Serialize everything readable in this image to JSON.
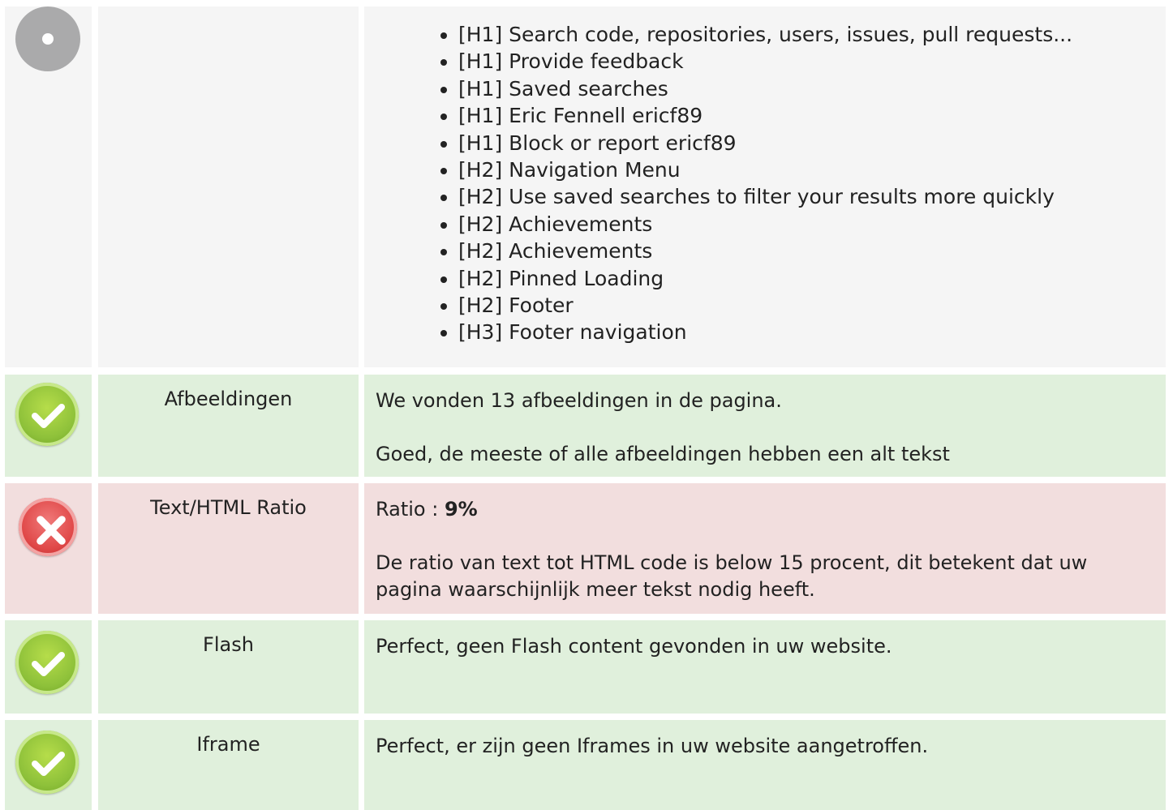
{
  "headings": {
    "status_icon": "info-circle-icon",
    "items": [
      "[H1] Search code, repositories, users, issues, pull requests...",
      "[H1] Provide feedback",
      "[H1] Saved searches",
      "[H1] Eric Fennell ericf89",
      "[H1] Block or report ericf89",
      "[H2] Navigation Menu",
      "[H2] Use saved searches to filter your results more quickly",
      "[H2] Achievements",
      "[H2] Achievements",
      "[H2] Pinned Loading",
      "[H2] Footer",
      "[H3] Footer navigation"
    ]
  },
  "images": {
    "status_icon": "check-circle-icon",
    "label": "Afbeeldingen",
    "line1": "We vonden 13 afbeeldingen in de pagina.",
    "line2": "Goed, de meeste of alle afbeeldingen hebben een alt tekst"
  },
  "ratio": {
    "status_icon": "cross-circle-icon",
    "label": "Text/HTML Ratio",
    "prefix": "Ratio : ",
    "value": "9%",
    "line2": "De ratio van text tot HTML code is below 15 procent, dit betekent dat uw pagina waarschijnlijk meer tekst nodig heeft."
  },
  "flash": {
    "status_icon": "check-circle-icon",
    "label": "Flash",
    "line1": "Perfect, geen Flash content gevonden in uw website."
  },
  "iframe": {
    "status_icon": "check-circle-icon",
    "label": "Iframe",
    "line1": "Perfect, er zijn geen Iframes in uw website aangetroffen."
  },
  "colors": {
    "ok_row": "#e0f0dc",
    "bad_row": "#f2dede",
    "neutral_row": "#f5f5f5"
  }
}
